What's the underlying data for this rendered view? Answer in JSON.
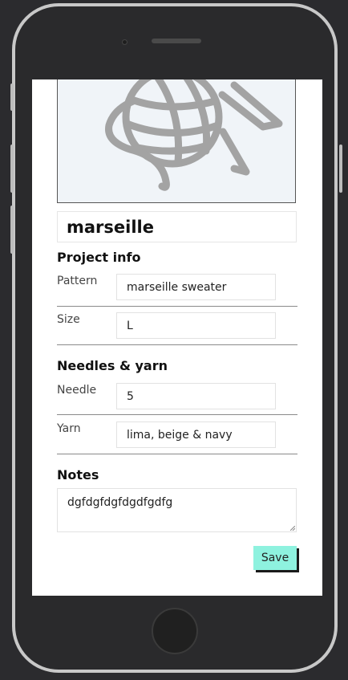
{
  "project": {
    "name": "marseille",
    "image_icon": "yarn-ball-icon"
  },
  "sections": {
    "project_info": "Project info",
    "needles_yarn": "Needles & yarn",
    "notes": "Notes"
  },
  "fields": {
    "pattern": {
      "label": "Pattern",
      "value": "marseille sweater"
    },
    "size": {
      "label": "Size",
      "value": "L"
    },
    "needle": {
      "label": "Needle",
      "value": "5"
    },
    "yarn": {
      "label": "Yarn",
      "value": "lima, beige & navy"
    }
  },
  "notes": {
    "value": "dgfdgfdgfdgdfgdfg"
  },
  "actions": {
    "save_label": "Save"
  },
  "colors": {
    "save_button": "#8ef2df",
    "image_background": "#f0f4f8",
    "icon_stroke": "#a3a3a3"
  }
}
